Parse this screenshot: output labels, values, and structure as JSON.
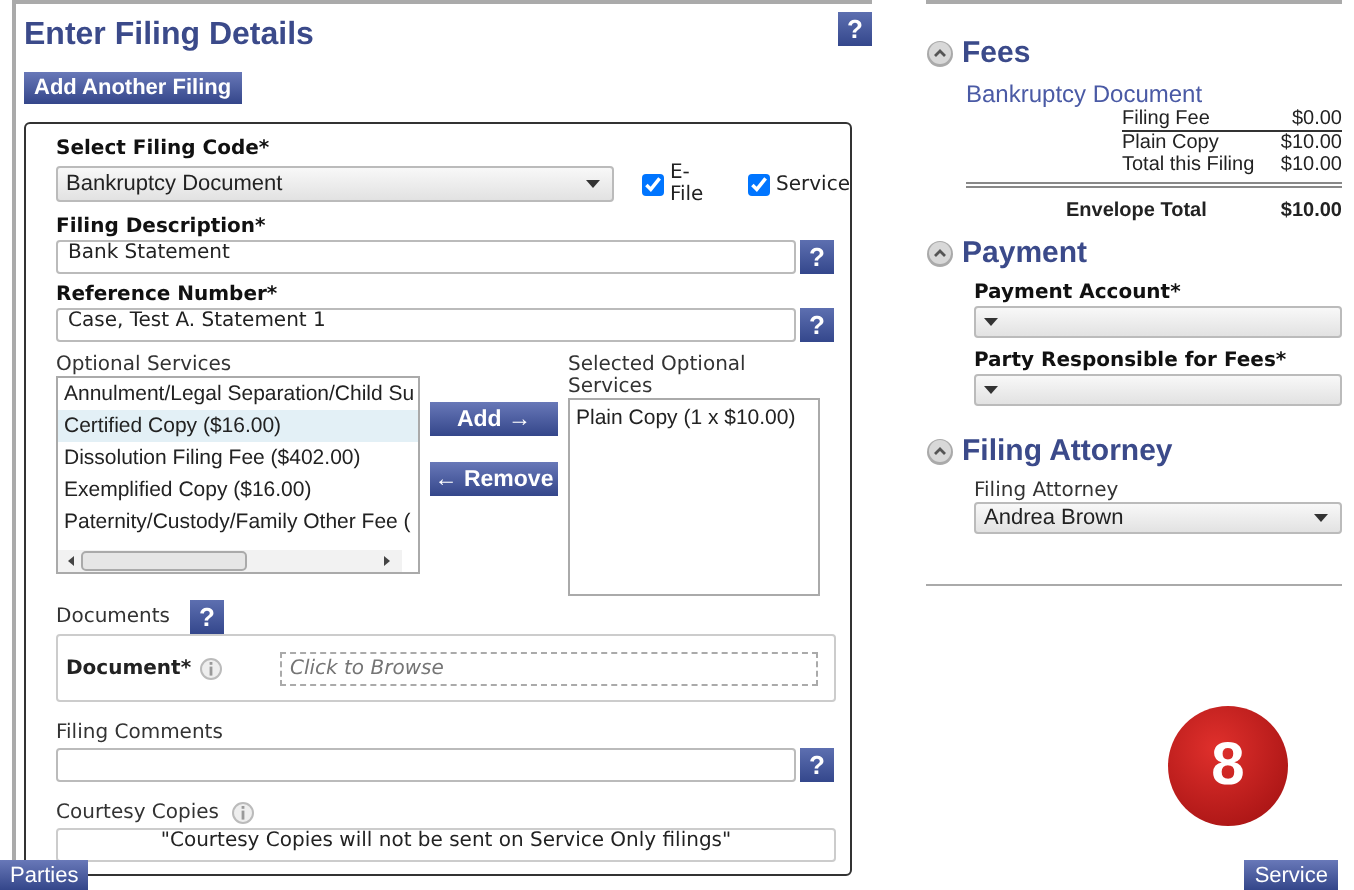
{
  "title": "Enter Filing Details",
  "title_help": "?",
  "add_button": "Add Another Filing",
  "filing_code": {
    "label": "Select Filing Code*",
    "value": "Bankruptcy Document"
  },
  "options": [
    {
      "label": "E-File",
      "checked": true
    },
    {
      "label": "Service",
      "checked": true
    }
  ],
  "description": {
    "label": "Filing Description*",
    "value": "Bank Statement",
    "help": "?"
  },
  "reference": {
    "label": "Reference Number*",
    "value": "Case, Test A. Statement 1",
    "help": "?"
  },
  "optional_services": {
    "label": "Optional Services",
    "items": [
      {
        "label": "Annulment/Legal Separation/Child Su",
        "selected": false
      },
      {
        "label": "Certified Copy ($16.00)",
        "selected": true
      },
      {
        "label": "Dissolution Filing Fee ($402.00)",
        "selected": false
      },
      {
        "label": "Exemplified Copy ($16.00)",
        "selected": false
      },
      {
        "label": "Paternity/Custody/Family Other Fee (",
        "selected": false
      }
    ]
  },
  "add": "Add →",
  "remove": "← Remove",
  "selected_services": {
    "label": "Selected Optional Services",
    "items": [
      "Plain Copy (1 x $10.00)"
    ]
  },
  "documents": {
    "label": "Documents",
    "help": "?",
    "document_label": "Document*",
    "placeholder": "Click to Browse"
  },
  "comments": {
    "label": "Filing Comments",
    "help": "?"
  },
  "courtesy": {
    "label": "Courtesy Copies",
    "note": "\"Courtesy Copies will not be sent on Service Only filings\""
  },
  "fees": {
    "title": "Fees",
    "filing": "Bankruptcy Document",
    "rows": [
      {
        "label": "Filing Fee",
        "amount": "$0.00"
      },
      {
        "label": "Plain Copy",
        "amount": "$10.00"
      },
      {
        "label": "Total this Filing",
        "amount": "$10.00"
      }
    ],
    "total_label": "Envelope Total",
    "total": "$10.00"
  },
  "payment": {
    "title": "Payment",
    "fields": [
      {
        "label": "Payment Account*"
      },
      {
        "label": "Party Responsible for Fees*"
      }
    ]
  },
  "attorney": {
    "title": "Filing Attorney",
    "label": "Filing Attorney",
    "value": "Andrea Brown"
  },
  "footer": {
    "back": "Parties",
    "next": "Service"
  },
  "step_badge": "8"
}
